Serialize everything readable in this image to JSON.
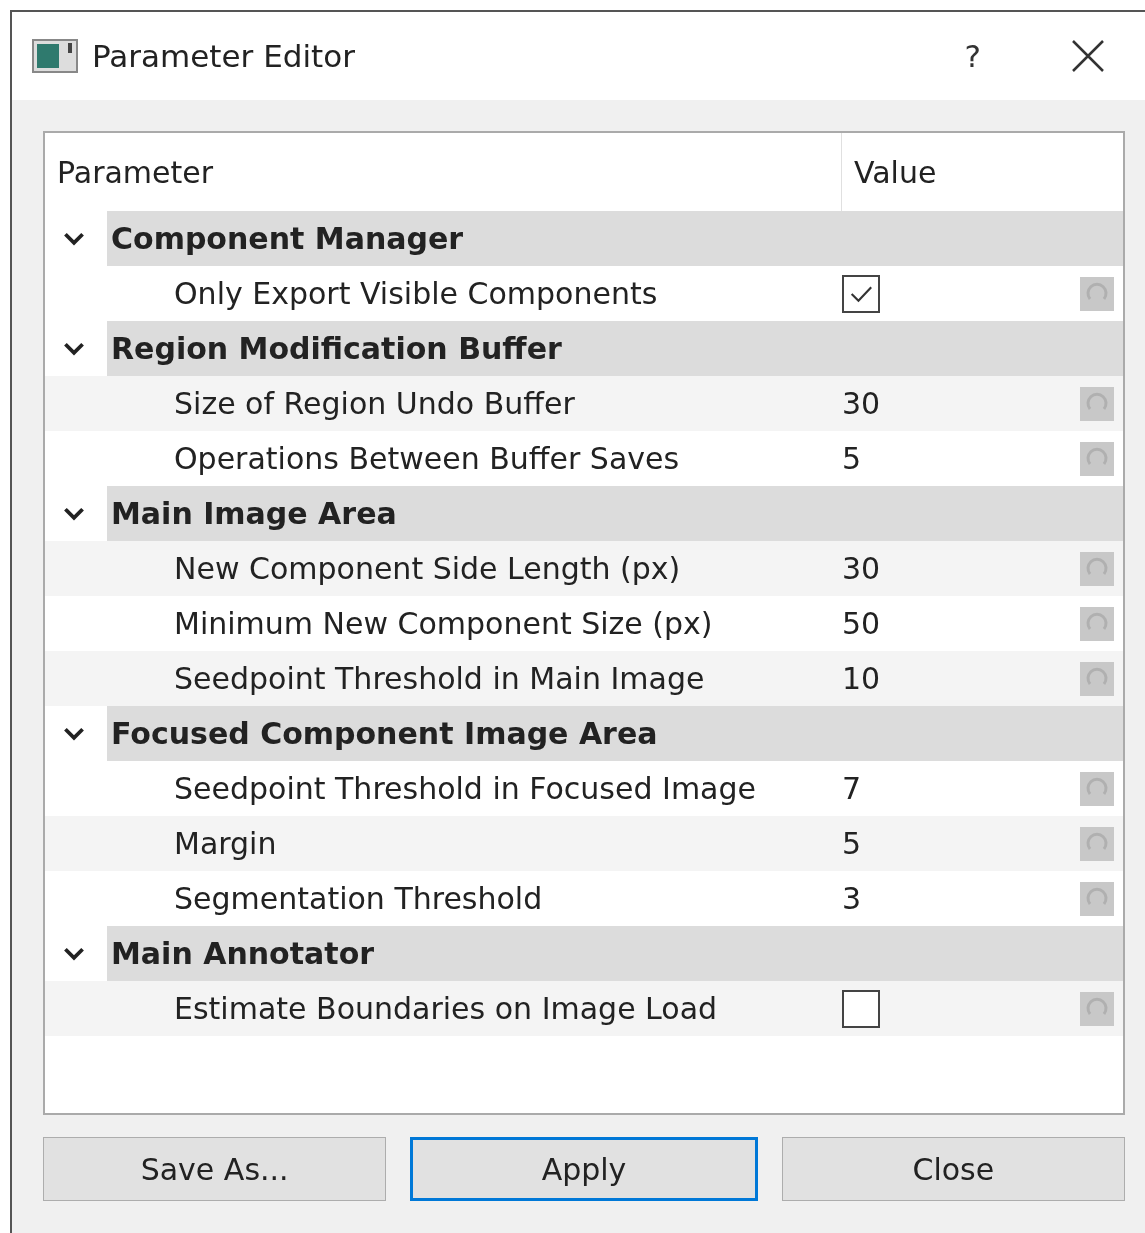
{
  "window": {
    "title": "Parameter Editor",
    "help": "?"
  },
  "table": {
    "columns": [
      "Parameter",
      "Value"
    ],
    "groups": [
      {
        "name": "Component Manager",
        "expanded": true,
        "rows": [
          {
            "name": "Only Export Visible Components",
            "kind": "checkbox",
            "checked": true
          }
        ]
      },
      {
        "name": "Region Modification Buffer",
        "expanded": true,
        "rows": [
          {
            "name": "Size of Region Undo Buffer",
            "kind": "number",
            "value": "30"
          },
          {
            "name": "Operations Between Buffer Saves",
            "kind": "number",
            "value": "5"
          }
        ]
      },
      {
        "name": "Main Image Area",
        "expanded": true,
        "rows": [
          {
            "name": "New Component Side Length (px)",
            "kind": "number",
            "value": "30"
          },
          {
            "name": "Minimum New Component Size (px)",
            "kind": "number",
            "value": "50"
          },
          {
            "name": "Seedpoint Threshold in Main Image",
            "kind": "number",
            "value": "10"
          }
        ]
      },
      {
        "name": "Focused Component Image Area",
        "expanded": true,
        "rows": [
          {
            "name": "Seedpoint Threshold in Focused Image",
            "kind": "number",
            "value": "7"
          },
          {
            "name": "Margin",
            "kind": "number",
            "value": "5"
          },
          {
            "name": "Segmentation Threshold",
            "kind": "number",
            "value": "3"
          }
        ]
      },
      {
        "name": "Main Annotator",
        "expanded": true,
        "rows": [
          {
            "name": "Estimate Boundaries on Image Load",
            "kind": "checkbox",
            "checked": false
          }
        ]
      }
    ]
  },
  "buttons": [
    {
      "label": "Save As...",
      "focused": false
    },
    {
      "label": "Apply",
      "focused": true
    },
    {
      "label": "Close",
      "focused": false
    }
  ]
}
